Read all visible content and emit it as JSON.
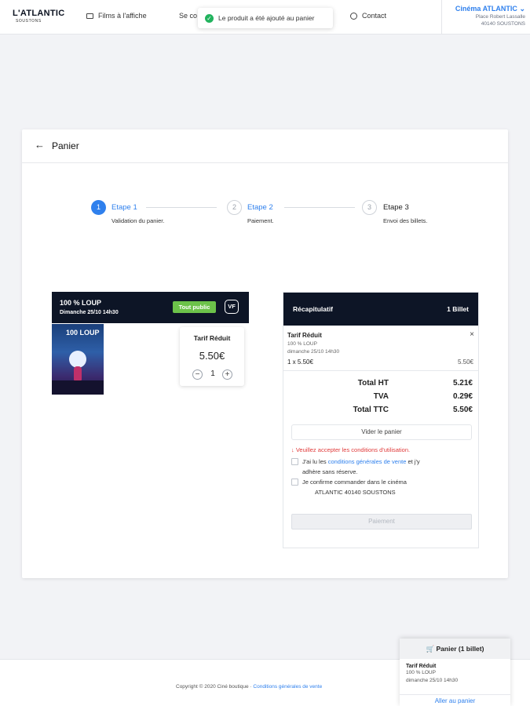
{
  "header": {
    "logo": "L'ATLANTIC",
    "logo_sub": "SOUSTONS",
    "nav_films": "Films à l'affiche",
    "nav_connect": "Se co",
    "nav_contact": "Contact",
    "cinema_name": "Cinéma ATLANTIC",
    "cinema_address_1": "Place Robert Lassalle",
    "cinema_address_2": "40140 SOUSTONS"
  },
  "toast": {
    "message": "Le produit a été ajouté au panier"
  },
  "card": {
    "title": "Panier",
    "steps": [
      {
        "number": "1",
        "label": "Etape 1",
        "desc": "Validation du panier."
      },
      {
        "number": "2",
        "label": "Etape 2",
        "desc": "Paiement."
      },
      {
        "number": "3",
        "label": "Etape 3",
        "desc": "Envoi des billets."
      }
    ]
  },
  "product": {
    "title": "100 % LOUP",
    "datetime": "Dimanche 25/10 14h30",
    "badge_public": "Tout public",
    "badge_version": "VF",
    "poster_text": "100 LOUP",
    "tarif_name": "Tarif Réduit",
    "tarif_price": "5.50€",
    "minus": "−",
    "quantity": "1",
    "plus": "+"
  },
  "recap": {
    "title": "Récapitulatif",
    "count": "1 Billet",
    "item": {
      "name": "Tarif Réduit",
      "film": "100 % LOUP",
      "date": "dimanche 25/10 14h30",
      "qty": "1 x 5.50€",
      "price": "5.50€",
      "close": "×"
    },
    "totals": [
      {
        "label": "Total HT",
        "value": "5.21€"
      },
      {
        "label": "TVA",
        "value": "0.29€"
      },
      {
        "label": "Total TTC",
        "value": "5.50€"
      }
    ],
    "empty_cart": "Vider le panier",
    "warning": "↓ Veuillez accepter les conditions d'utilisation.",
    "cgv_prefix": "J'ai lu les",
    "cgv_link": "conditions générales de vente",
    "cgv_suffix": "et j'y",
    "cgv_line2": "adhère sans réserve.",
    "confirm_line1": "Je confirme commander dans le cinéma",
    "confirm_line2": "ATLANTIC 40140 SOUSTONS",
    "pay_button": "Paiement"
  },
  "footer": {
    "copyright": "Copyright © 2020 Ciné boutique",
    "separator": " · ",
    "cgv_link": "Conditions générales de vente"
  },
  "mini_cart": {
    "title": "Panier (1 billet)",
    "item_name": "Tarif Réduit",
    "item_film": "100 % LOUP",
    "item_date": "dimanche 25/10 14h30",
    "link": "Aller au panier"
  },
  "colors": {
    "accent": "#2f80ed",
    "dark_header": "#0d1526",
    "badge_green": "#6cc24a",
    "warning_red": "#e03a3a",
    "toast_check": "#22b35e"
  }
}
